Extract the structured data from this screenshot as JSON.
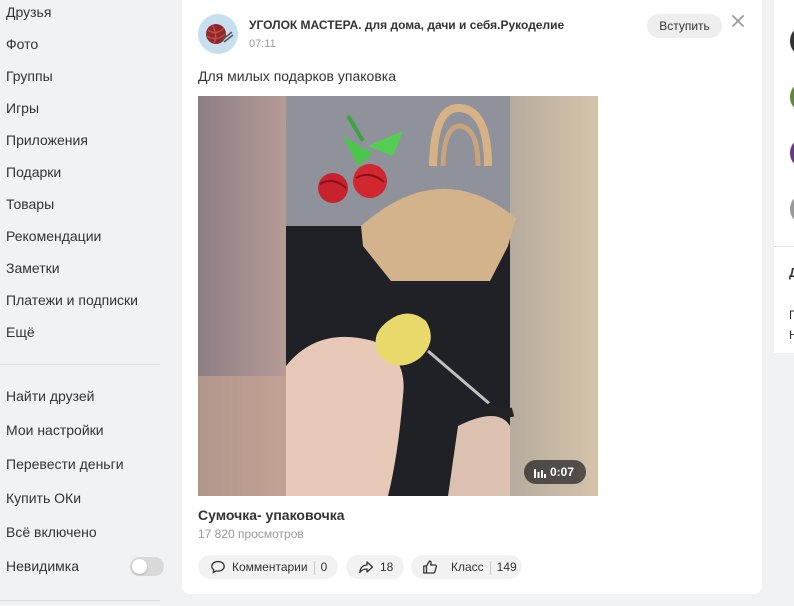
{
  "nav": {
    "top_items": [
      "Друзья",
      "Фото",
      "Группы",
      "Игры",
      "Приложения",
      "Подарки",
      "Товары",
      "Рекомендации",
      "Заметки",
      "Платежи и подписки",
      "Ещё"
    ],
    "bottom_items": [
      "Найти друзей",
      "Мои настройки",
      "Перевести деньги",
      "Купить ОКи",
      "Всё включено",
      "Невидимка"
    ]
  },
  "post": {
    "group_name": "УГОЛОК МАСТЕРА. для дома, дачи и себя.Рукоделие",
    "time": "07:11",
    "join_label": "Вступить",
    "text": "Для милых подарков упаковка",
    "video": {
      "duration": "0:07",
      "title": "Сумочка- упаковочка",
      "views": "17 820 просмотров"
    },
    "actions": {
      "comments_label": "Комментарии",
      "comments_count": "0",
      "shares_count": "18",
      "likes_label": "Класс",
      "likes_count": "149"
    }
  },
  "right_col": {
    "letter_1": "Д",
    "letter_2": "П",
    "letter_3": "Н"
  }
}
